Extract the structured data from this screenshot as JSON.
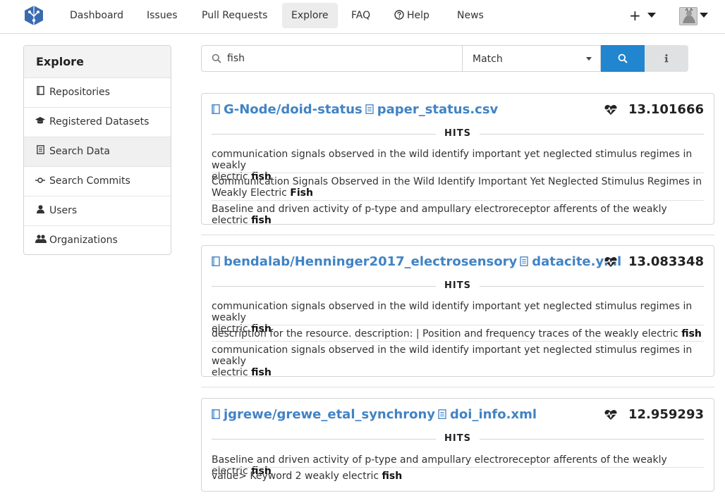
{
  "nav": {
    "items": [
      "Dashboard",
      "Issues",
      "Pull Requests",
      "Explore",
      "FAQ",
      "Help",
      "News"
    ],
    "plus": "+"
  },
  "sidebar": {
    "title": "Explore",
    "items": [
      {
        "label": "Repositories",
        "icon": "book-icon"
      },
      {
        "label": "Registered Datasets",
        "icon": "graduation-cap-icon"
      },
      {
        "label": "Search Data",
        "icon": "file-text-icon"
      },
      {
        "label": "Search Commits",
        "icon": "commit-icon"
      },
      {
        "label": "Users",
        "icon": "user-icon"
      },
      {
        "label": "Organizations",
        "icon": "users-icon"
      }
    ]
  },
  "search": {
    "query": "fish",
    "mode": "Match"
  },
  "results": [
    {
      "repo": "G-Node/doid-status",
      "file": "paper_status.csv",
      "score": "13.101666",
      "hits_label": "HITS",
      "hits": [
        {
          "line1": "communication signals observed in the wild identify important yet neglected stimulus regimes in weakly",
          "line2": "electric ",
          "bold": "fish"
        },
        {
          "line1": "Communication Signals Observed in the Wild Identify Important Yet Neglected Stimulus Regimes in",
          "line2": "Weakly Electric ",
          "bold": "Fish"
        },
        {
          "line1": "",
          "line2": "Baseline and driven activity of p-type and ampullary electroreceptor afferents of the weakly electric ",
          "bold": "fish"
        }
      ]
    },
    {
      "repo": "bendalab/Henninger2017_electrosensory",
      "file": "datacite.yml",
      "score": "13.083348",
      "hits_label": "HITS",
      "hits": [
        {
          "line1": "communication signals observed in the wild identify important yet neglected stimulus regimes in weakly",
          "line2": "electric ",
          "bold": "fish"
        },
        {
          "line1": "",
          "line2": "description for the resource. description: | Position and frequency traces of the weakly electric ",
          "bold": "fish"
        },
        {
          "line1": "communication signals observed in the wild identify important yet neglected stimulus regimes in weakly",
          "line2": "electric ",
          "bold": "fish"
        }
      ]
    },
    {
      "repo": "jgrewe/grewe_etal_synchrony",
      "file": "doi_info.xml",
      "score": "12.959293",
      "hits_label": "HITS",
      "hits": [
        {
          "line1": "",
          "line2": "Baseline and driven activity of p-type and ampullary electroreceptor afferents of the weakly electric ",
          "bold": "fish"
        },
        {
          "line1": "",
          "line2": "value> Keyword 2 weakly electric ",
          "bold": "fish"
        }
      ]
    }
  ],
  "colors": {
    "link": "#4183c4",
    "primary_button": "#2185d0",
    "secondary_button": "#e0e1e2"
  }
}
